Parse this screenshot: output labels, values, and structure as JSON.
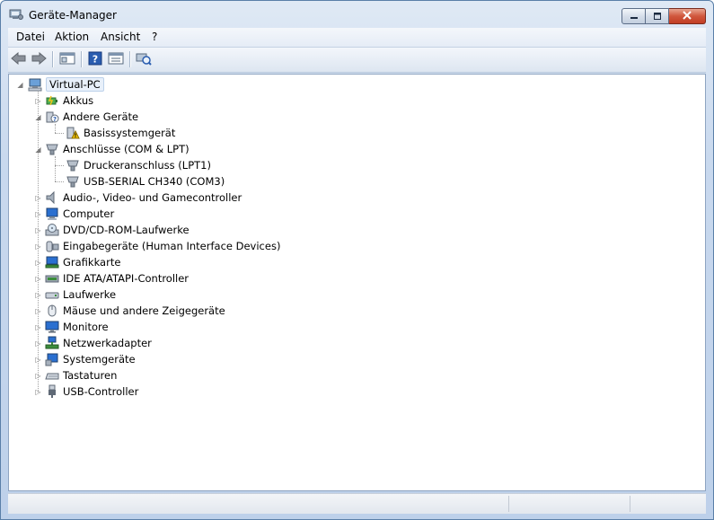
{
  "window": {
    "title": "Geräte-Manager",
    "minimize_icon": "minimize-icon",
    "maximize_icon": "maximize-icon",
    "close_icon": "close-icon"
  },
  "menu": {
    "items": [
      {
        "label": "Datei"
      },
      {
        "label": "Aktion"
      },
      {
        "label": "Ansicht"
      },
      {
        "label": "?"
      }
    ]
  },
  "toolbar": {
    "buttons": [
      {
        "icon": "back-arrow-icon"
      },
      {
        "icon": "forward-arrow-icon"
      },
      {
        "icon": "show-hide-console-tree-icon"
      },
      {
        "icon": "help-icon"
      },
      {
        "icon": "properties-icon"
      },
      {
        "icon": "scan-hardware-icon"
      }
    ]
  },
  "tree": {
    "root": {
      "label": "Virtual-PC",
      "icon": "computer-icon",
      "expanded": true
    },
    "nodes": [
      {
        "label": "Akkus",
        "icon": "battery-icon",
        "expanded": false,
        "level": 1
      },
      {
        "label": "Andere Geräte",
        "icon": "unknown-device-icon",
        "expanded": true,
        "level": 1
      },
      {
        "label": "Basissystemgerät",
        "icon": "warning-device-icon",
        "level": 2
      },
      {
        "label": "Anschlüsse (COM & LPT)",
        "icon": "port-icon",
        "expanded": true,
        "level": 1
      },
      {
        "label": "Druckeranschluss (LPT1)",
        "icon": "port-icon",
        "level": 2
      },
      {
        "label": "USB-SERIAL CH340 (COM3)",
        "icon": "port-icon",
        "level": 2
      },
      {
        "label": "Audio-, Video- und Gamecontroller",
        "icon": "speaker-icon",
        "expanded": false,
        "level": 1
      },
      {
        "label": "Computer",
        "icon": "computer-icon",
        "expanded": false,
        "level": 1
      },
      {
        "label": "DVD/CD-ROM-Laufwerke",
        "icon": "dvd-drive-icon",
        "expanded": false,
        "level": 1
      },
      {
        "label": "Eingabegeräte (Human Interface Devices)",
        "icon": "hid-icon",
        "expanded": false,
        "level": 1
      },
      {
        "label": "Grafikkarte",
        "icon": "display-adapter-icon",
        "expanded": false,
        "level": 1
      },
      {
        "label": "IDE ATA/ATAPI-Controller",
        "icon": "ide-controller-icon",
        "expanded": false,
        "level": 1
      },
      {
        "label": "Laufwerke",
        "icon": "disk-drive-icon",
        "expanded": false,
        "level": 1
      },
      {
        "label": "Mäuse und andere Zeigegeräte",
        "icon": "mouse-icon",
        "expanded": false,
        "level": 1
      },
      {
        "label": "Monitore",
        "icon": "monitor-icon",
        "expanded": false,
        "level": 1
      },
      {
        "label": "Netzwerkadapter",
        "icon": "network-adapter-icon",
        "expanded": false,
        "level": 1
      },
      {
        "label": "Systemgeräte",
        "icon": "system-device-icon",
        "expanded": false,
        "level": 1
      },
      {
        "label": "Tastaturen",
        "icon": "keyboard-icon",
        "expanded": false,
        "level": 1
      },
      {
        "label": "USB-Controller",
        "icon": "usb-icon",
        "expanded": false,
        "level": 1
      }
    ]
  },
  "colors": {
    "frame": "#bdd0ea",
    "close_button": "#c23d24",
    "selection": "#e8f0fa"
  }
}
